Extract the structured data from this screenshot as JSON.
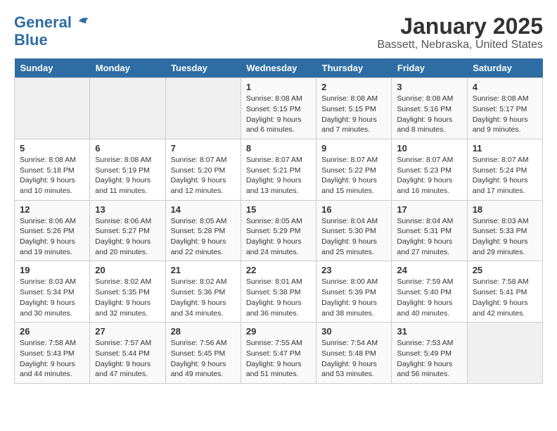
{
  "logo": {
    "line1": "General",
    "line2": "Blue"
  },
  "title": "January 2025",
  "subtitle": "Bassett, Nebraska, United States",
  "weekdays": [
    "Sunday",
    "Monday",
    "Tuesday",
    "Wednesday",
    "Thursday",
    "Friday",
    "Saturday"
  ],
  "weeks": [
    [
      {
        "day": "",
        "detail": ""
      },
      {
        "day": "",
        "detail": ""
      },
      {
        "day": "",
        "detail": ""
      },
      {
        "day": "1",
        "detail": "Sunrise: 8:08 AM\nSunset: 5:15 PM\nDaylight: 9 hours\nand 6 minutes."
      },
      {
        "day": "2",
        "detail": "Sunrise: 8:08 AM\nSunset: 5:15 PM\nDaylight: 9 hours\nand 7 minutes."
      },
      {
        "day": "3",
        "detail": "Sunrise: 8:08 AM\nSunset: 5:16 PM\nDaylight: 9 hours\nand 8 minutes."
      },
      {
        "day": "4",
        "detail": "Sunrise: 8:08 AM\nSunset: 5:17 PM\nDaylight: 9 hours\nand 9 minutes."
      }
    ],
    [
      {
        "day": "5",
        "detail": "Sunrise: 8:08 AM\nSunset: 5:18 PM\nDaylight: 9 hours\nand 10 minutes."
      },
      {
        "day": "6",
        "detail": "Sunrise: 8:08 AM\nSunset: 5:19 PM\nDaylight: 9 hours\nand 11 minutes."
      },
      {
        "day": "7",
        "detail": "Sunrise: 8:07 AM\nSunset: 5:20 PM\nDaylight: 9 hours\nand 12 minutes."
      },
      {
        "day": "8",
        "detail": "Sunrise: 8:07 AM\nSunset: 5:21 PM\nDaylight: 9 hours\nand 13 minutes."
      },
      {
        "day": "9",
        "detail": "Sunrise: 8:07 AM\nSunset: 5:22 PM\nDaylight: 9 hours\nand 15 minutes."
      },
      {
        "day": "10",
        "detail": "Sunrise: 8:07 AM\nSunset: 5:23 PM\nDaylight: 9 hours\nand 16 minutes."
      },
      {
        "day": "11",
        "detail": "Sunrise: 8:07 AM\nSunset: 5:24 PM\nDaylight: 9 hours\nand 17 minutes."
      }
    ],
    [
      {
        "day": "12",
        "detail": "Sunrise: 8:06 AM\nSunset: 5:26 PM\nDaylight: 9 hours\nand 19 minutes."
      },
      {
        "day": "13",
        "detail": "Sunrise: 8:06 AM\nSunset: 5:27 PM\nDaylight: 9 hours\nand 20 minutes."
      },
      {
        "day": "14",
        "detail": "Sunrise: 8:05 AM\nSunset: 5:28 PM\nDaylight: 9 hours\nand 22 minutes."
      },
      {
        "day": "15",
        "detail": "Sunrise: 8:05 AM\nSunset: 5:29 PM\nDaylight: 9 hours\nand 24 minutes."
      },
      {
        "day": "16",
        "detail": "Sunrise: 8:04 AM\nSunset: 5:30 PM\nDaylight: 9 hours\nand 25 minutes."
      },
      {
        "day": "17",
        "detail": "Sunrise: 8:04 AM\nSunset: 5:31 PM\nDaylight: 9 hours\nand 27 minutes."
      },
      {
        "day": "18",
        "detail": "Sunrise: 8:03 AM\nSunset: 5:33 PM\nDaylight: 9 hours\nand 29 minutes."
      }
    ],
    [
      {
        "day": "19",
        "detail": "Sunrise: 8:03 AM\nSunset: 5:34 PM\nDaylight: 9 hours\nand 30 minutes."
      },
      {
        "day": "20",
        "detail": "Sunrise: 8:02 AM\nSunset: 5:35 PM\nDaylight: 9 hours\nand 32 minutes."
      },
      {
        "day": "21",
        "detail": "Sunrise: 8:02 AM\nSunset: 5:36 PM\nDaylight: 9 hours\nand 34 minutes."
      },
      {
        "day": "22",
        "detail": "Sunrise: 8:01 AM\nSunset: 5:38 PM\nDaylight: 9 hours\nand 36 minutes."
      },
      {
        "day": "23",
        "detail": "Sunrise: 8:00 AM\nSunset: 5:39 PM\nDaylight: 9 hours\nand 38 minutes."
      },
      {
        "day": "24",
        "detail": "Sunrise: 7:59 AM\nSunset: 5:40 PM\nDaylight: 9 hours\nand 40 minutes."
      },
      {
        "day": "25",
        "detail": "Sunrise: 7:58 AM\nSunset: 5:41 PM\nDaylight: 9 hours\nand 42 minutes."
      }
    ],
    [
      {
        "day": "26",
        "detail": "Sunrise: 7:58 AM\nSunset: 5:43 PM\nDaylight: 9 hours\nand 44 minutes."
      },
      {
        "day": "27",
        "detail": "Sunrise: 7:57 AM\nSunset: 5:44 PM\nDaylight: 9 hours\nand 47 minutes."
      },
      {
        "day": "28",
        "detail": "Sunrise: 7:56 AM\nSunset: 5:45 PM\nDaylight: 9 hours\nand 49 minutes."
      },
      {
        "day": "29",
        "detail": "Sunrise: 7:55 AM\nSunset: 5:47 PM\nDaylight: 9 hours\nand 51 minutes."
      },
      {
        "day": "30",
        "detail": "Sunrise: 7:54 AM\nSunset: 5:48 PM\nDaylight: 9 hours\nand 53 minutes."
      },
      {
        "day": "31",
        "detail": "Sunrise: 7:53 AM\nSunset: 5:49 PM\nDaylight: 9 hours\nand 56 minutes."
      },
      {
        "day": "",
        "detail": ""
      }
    ]
  ]
}
